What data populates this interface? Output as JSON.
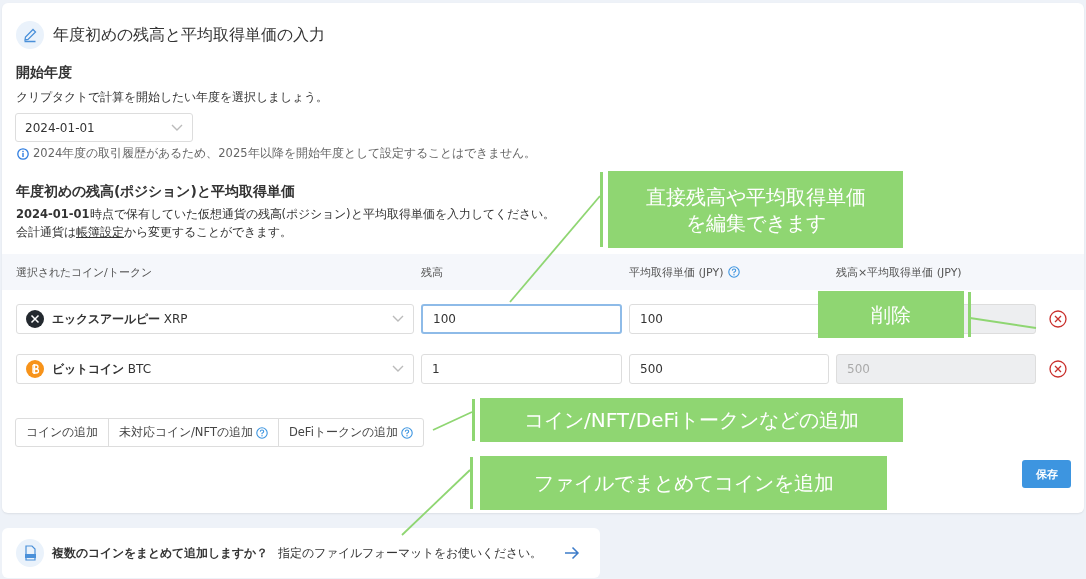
{
  "title": "年度初めの残高と平均取得単価の入力",
  "start_year": {
    "heading": "開始年度",
    "description": "クリプタクトで計算を開始したい年度を選択しましょう。",
    "value": "2024-01-01",
    "info": "2024年度の取引履歴があるため、2025年以降を開始年度として設定することはできません。"
  },
  "positions": {
    "heading": "年度初めの残高(ポジション)と平均取得単価",
    "description": "**2024-01-01**時点で保有していた仮想通貨の残高(ポジション)と平均取得単価を入力してください。",
    "note_before": "会計通貨は",
    "note_link": "帳簿設定",
    "note_after": "から変更することができます。",
    "columns": [
      {
        "label": "選択されたコイン/トークン",
        "help": false
      },
      {
        "label": "残高",
        "help": false
      },
      {
        "label": "平均取得単価 (JPY)",
        "help": true
      },
      {
        "label": "残高×平均取得単価 (JPY)",
        "help": false
      }
    ],
    "rows": [
      {
        "kind": "xrp",
        "name": "エックスアールピー",
        "symbol": "XRP",
        "balance": "100",
        "balance_focused": true,
        "price": "100"
      },
      {
        "kind": "btc",
        "name": "ビットコイン",
        "symbol": "BTC",
        "balance": "1",
        "balance_focused": false,
        "price": "500",
        "total": "500"
      }
    ],
    "add_buttons": [
      {
        "label": "コインの追加",
        "help": false
      },
      {
        "label": "未対応コイン/NFTの追加",
        "help": true
      },
      {
        "label": "DeFiトークンの追加",
        "help": true
      }
    ],
    "save": "保存"
  },
  "csv_banner": {
    "question": "複数のコインをまとめて追加しますか？",
    "hint": "指定のファイルフォーマットをお使いください。"
  },
  "annotations": [
    "直接残高や平均取得単価を編集できます",
    "削除",
    "コイン/NFT/DeFiトークンなどの追加",
    "ファイルでまとめてコインを追加"
  ]
}
